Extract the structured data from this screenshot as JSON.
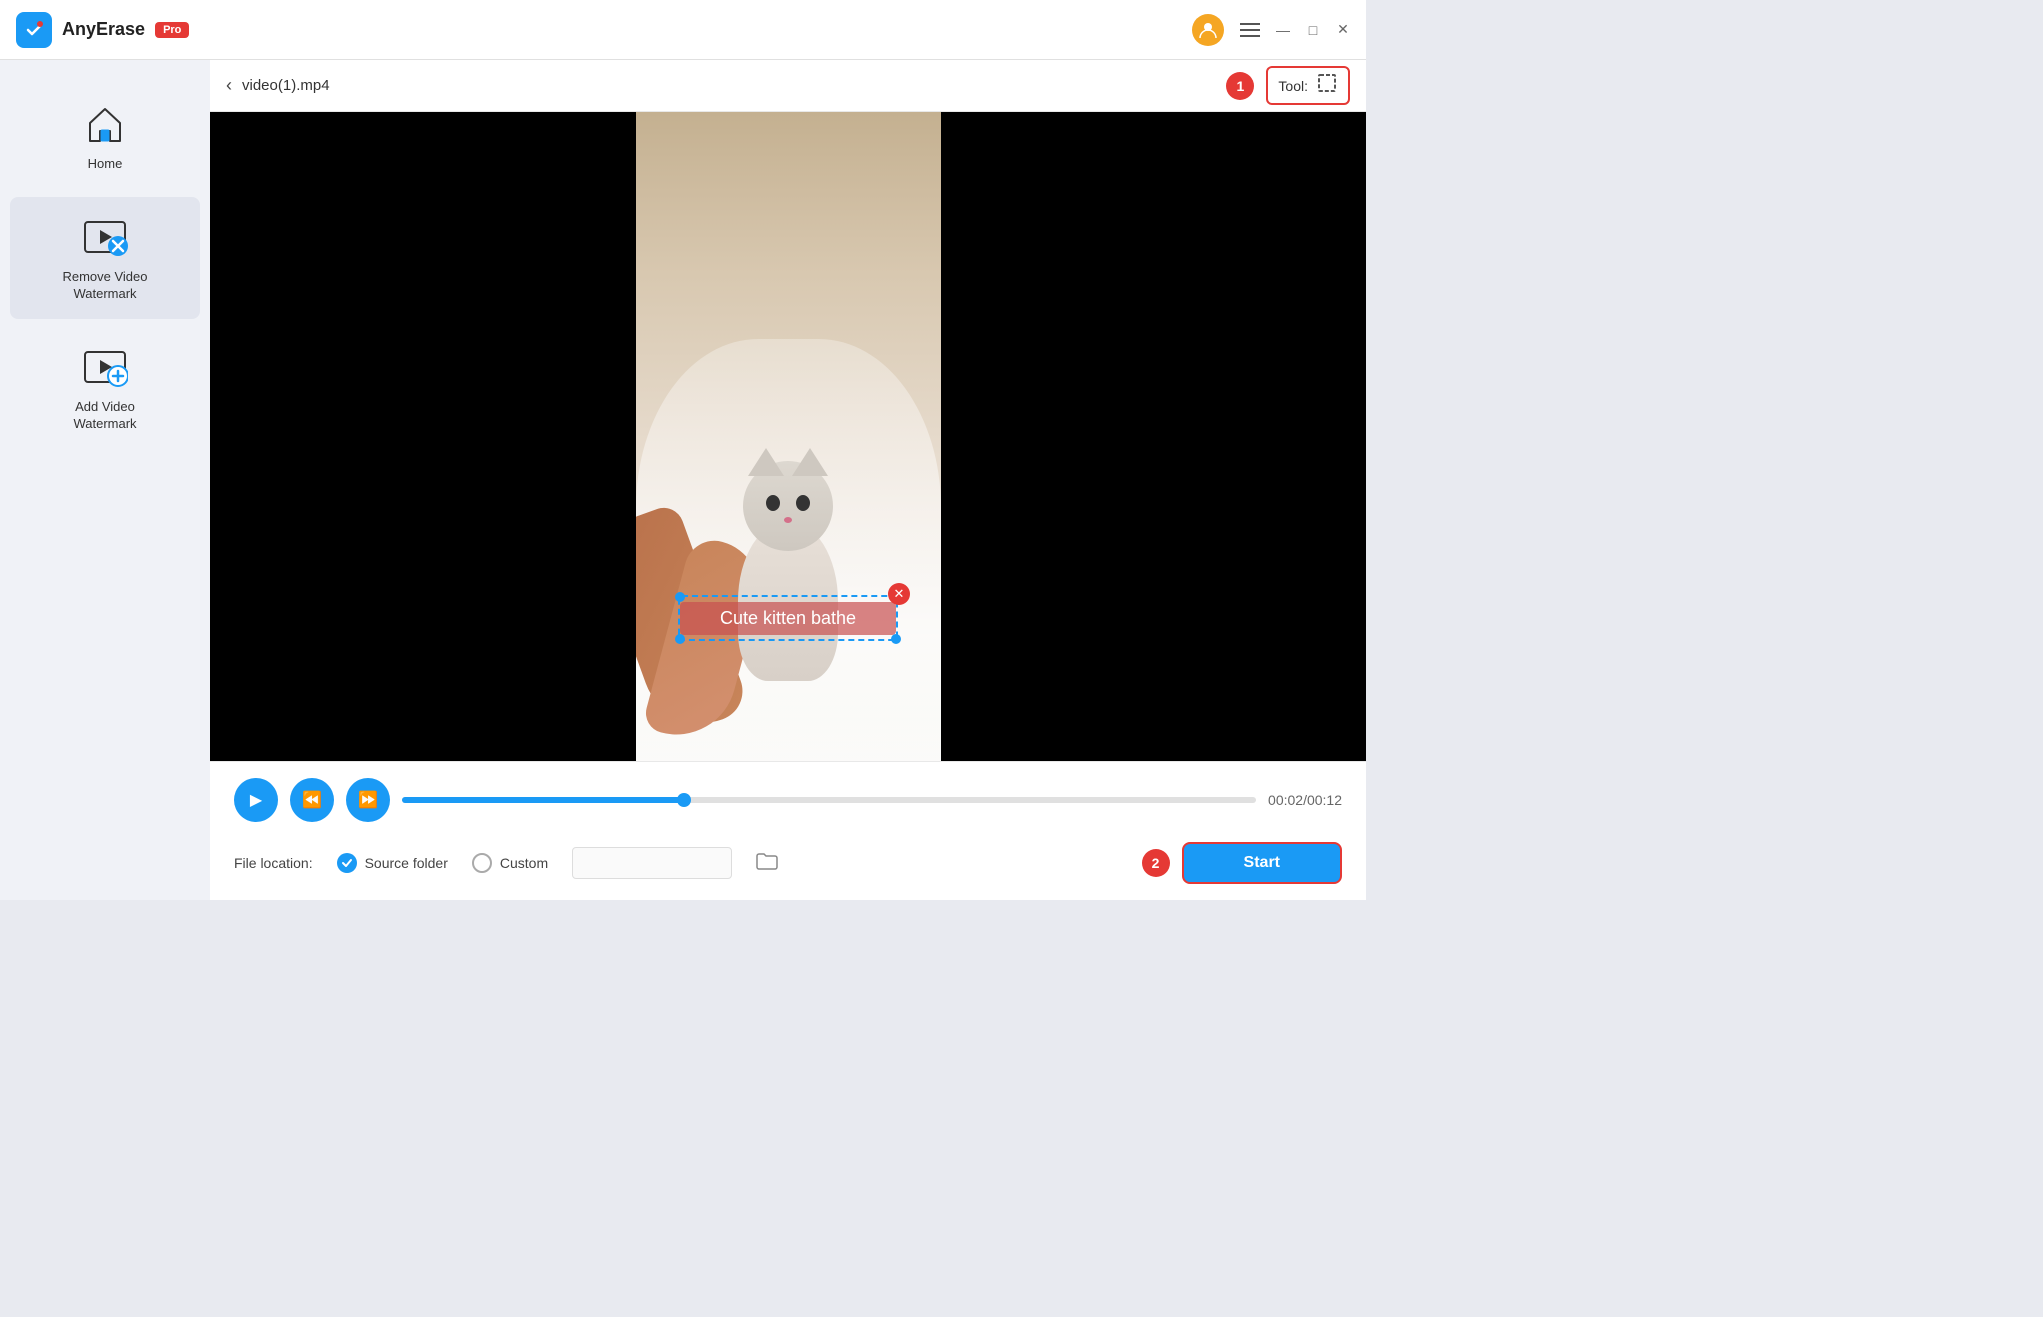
{
  "titlebar": {
    "app_name": "AnyErase",
    "pro_label": "Pro",
    "avatar_icon": "👤",
    "minimize": "—",
    "maximize": "□",
    "close": "✕"
  },
  "sidebar": {
    "items": [
      {
        "id": "home",
        "label": "Home",
        "active": false
      },
      {
        "id": "remove-watermark",
        "label": "Remove Video\nWatermark",
        "active": true
      },
      {
        "id": "add-watermark",
        "label": "Add Video\nWatermark",
        "active": false
      }
    ]
  },
  "video_header": {
    "back_arrow": "‹",
    "filename": "video(1).mp4",
    "step1_label": "1",
    "tool_label": "Tool:",
    "tool_icon": "⬚"
  },
  "watermark": {
    "text": "Cute kitten bathe"
  },
  "controls": {
    "play_icon": "▶",
    "rewind_icon": "◀◀",
    "forward_icon": "▶▶",
    "current_time": "00:02/00:12"
  },
  "file_location": {
    "label": "File location:",
    "source_folder_label": "Source folder",
    "custom_label": "Custom",
    "path_placeholder": "",
    "step2_label": "2",
    "start_label": "Start"
  }
}
